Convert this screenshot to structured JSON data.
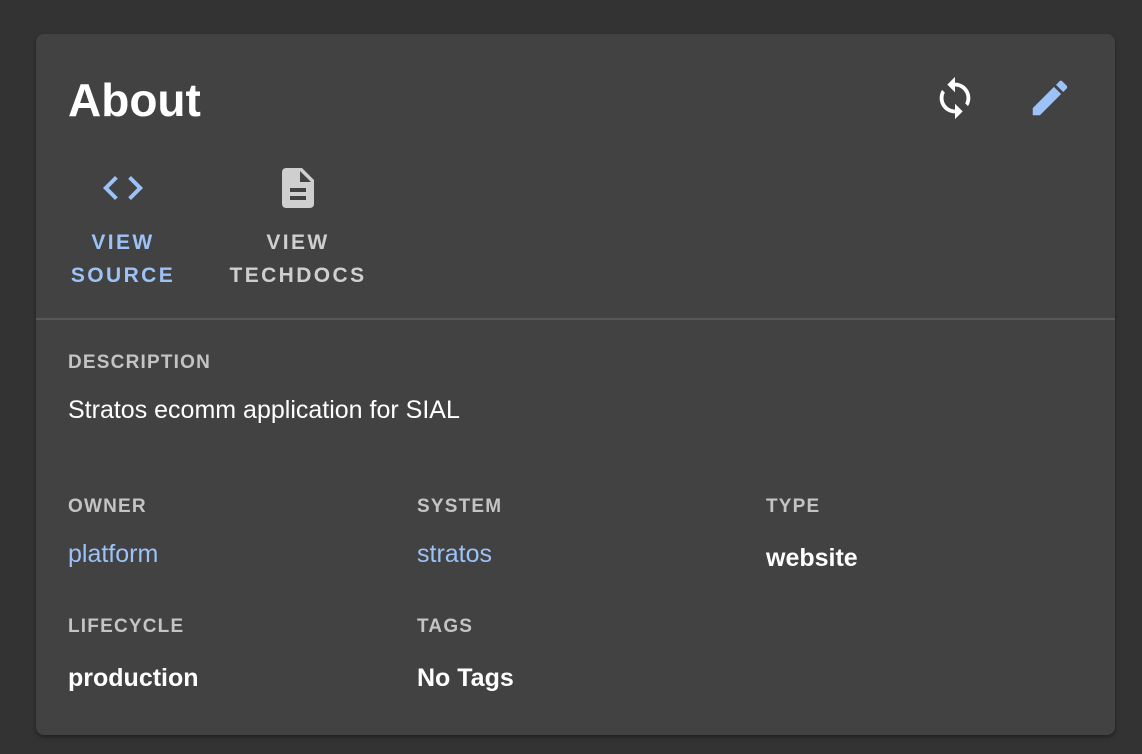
{
  "card": {
    "title": "About",
    "actions": {
      "refresh_icon": "refresh-icon",
      "edit_icon": "edit-icon"
    },
    "links": [
      {
        "line1": "VIEW",
        "line2": "SOURCE",
        "icon": "code-icon",
        "color": "#9cc2f7"
      },
      {
        "line1": "VIEW",
        "line2": "TECHDOCS",
        "icon": "document-icon",
        "color": "#cfcfcf"
      }
    ]
  },
  "fields": {
    "description": {
      "label": "DESCRIPTION",
      "value": "Stratos ecomm application for SIAL"
    },
    "owner": {
      "label": "OWNER",
      "value": "platform"
    },
    "system": {
      "label": "SYSTEM",
      "value": "stratos"
    },
    "type": {
      "label": "TYPE",
      "value": "website"
    },
    "lifecycle": {
      "label": "LIFECYCLE",
      "value": "production"
    },
    "tags": {
      "label": "TAGS",
      "value": "No Tags"
    }
  },
  "colors": {
    "background": "#333333",
    "card": "#424242",
    "accent": "#9cc2f7",
    "text": "#ffffff",
    "muted": "#c4c4c4"
  }
}
